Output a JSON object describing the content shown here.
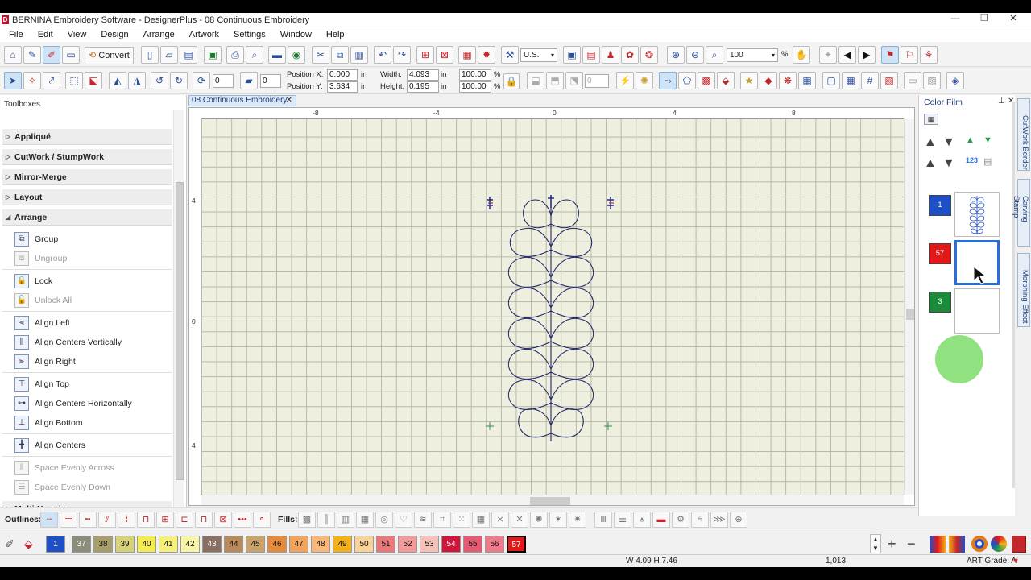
{
  "window": {
    "title": "BERNINA Embroidery Software - DesignerPlus - 08 Continuous Embroidery",
    "logo": "D",
    "controls": [
      "—",
      "❐",
      "✕"
    ]
  },
  "menu": [
    "File",
    "Edit",
    "View",
    "Design",
    "Arrange",
    "Artwork",
    "Settings",
    "Window",
    "Help"
  ],
  "toolbar": {
    "convert_label": "Convert",
    "units": "U.S.",
    "zoom": "100",
    "zoom_unit": "%",
    "rotate_angle": "0",
    "slant_angle": "0",
    "counter_value": "0",
    "position_x_label": "Position X:",
    "position_x": "0.000",
    "position_y_label": "Position Y:",
    "position_y": "3.634",
    "width_label": "Width:",
    "width": "4.093",
    "height_label": "Height:",
    "height": "0.195",
    "unit_in": "in",
    "scale_w": "100.00",
    "scale_h": "100.00",
    "pct": "%"
  },
  "toolbox": {
    "header": "Toolboxes",
    "sections": [
      "Appliqué",
      "CutWork / StumpWork",
      "Mirror-Merge",
      "Layout",
      "Arrange",
      "Multi-Hooping"
    ],
    "arrange_items": [
      {
        "label": "Group",
        "enabled": true
      },
      {
        "label": "Ungroup",
        "enabled": false
      },
      {
        "label": "Lock",
        "enabled": true
      },
      {
        "label": "Unlock All",
        "enabled": false
      },
      {
        "label": "Align Left",
        "enabled": true
      },
      {
        "label": "Align Centers Vertically",
        "enabled": true
      },
      {
        "label": "Align Right",
        "enabled": true
      },
      {
        "label": "Align Top",
        "enabled": true
      },
      {
        "label": "Align Centers Horizontally",
        "enabled": true
      },
      {
        "label": "Align Bottom",
        "enabled": true
      },
      {
        "label": "Align Centers",
        "enabled": true
      },
      {
        "label": "Space Evenly Across",
        "enabled": false
      },
      {
        "label": "Space Evenly Down",
        "enabled": false
      }
    ]
  },
  "document": {
    "tab_title": "08 Continuous Embroidery",
    "ruler_h": [
      "-8",
      "-4",
      "0",
      "4",
      "8"
    ],
    "ruler_v": [
      "4",
      "0",
      "4"
    ]
  },
  "color_film": {
    "header": "Color Film",
    "entries": [
      {
        "number": "1",
        "color": "#1f4fc6"
      },
      {
        "number": "57",
        "color": "#e31919"
      },
      {
        "number": "3",
        "color": "#1c8a3a"
      }
    ]
  },
  "side_tabs": [
    "CutWork Border",
    "Carving Stamp",
    "Morphing Effect"
  ],
  "outlines_label": "Outlines:",
  "fills_label": "Fills:",
  "palette": [
    {
      "n": "1",
      "color": "#1f4fc6"
    },
    {
      "n": "37",
      "color": "#8c8c7a"
    },
    {
      "n": "38",
      "color": "#a79e6a"
    },
    {
      "n": "39",
      "color": "#d7d27a"
    },
    {
      "n": "40",
      "color": "#f4ec4f"
    },
    {
      "n": "41",
      "color": "#f6f07a"
    },
    {
      "n": "42",
      "color": "#f8f4a8"
    },
    {
      "n": "43",
      "color": "#8a7060"
    },
    {
      "n": "44",
      "color": "#b88a5a"
    },
    {
      "n": "45",
      "color": "#c9a36a"
    },
    {
      "n": "46",
      "color": "#e68a3a"
    },
    {
      "n": "47",
      "color": "#f3a35a"
    },
    {
      "n": "48",
      "color": "#f7b87a"
    },
    {
      "n": "49",
      "color": "#f3b018"
    },
    {
      "n": "50",
      "color": "#f9d29a"
    },
    {
      "n": "51",
      "color": "#e8787a"
    },
    {
      "n": "52",
      "color": "#f39a9a"
    },
    {
      "n": "53",
      "color": "#f6c1b8"
    },
    {
      "n": "54",
      "color": "#d2143a"
    },
    {
      "n": "55",
      "color": "#e45a70"
    },
    {
      "n": "56",
      "color": "#f07a8a"
    },
    {
      "n": "57",
      "color": "#e31919"
    }
  ],
  "status": {
    "dimensions": "W 4.09 H 7.46",
    "stitches": "1,013",
    "art_grade": "ART Grade: A"
  }
}
